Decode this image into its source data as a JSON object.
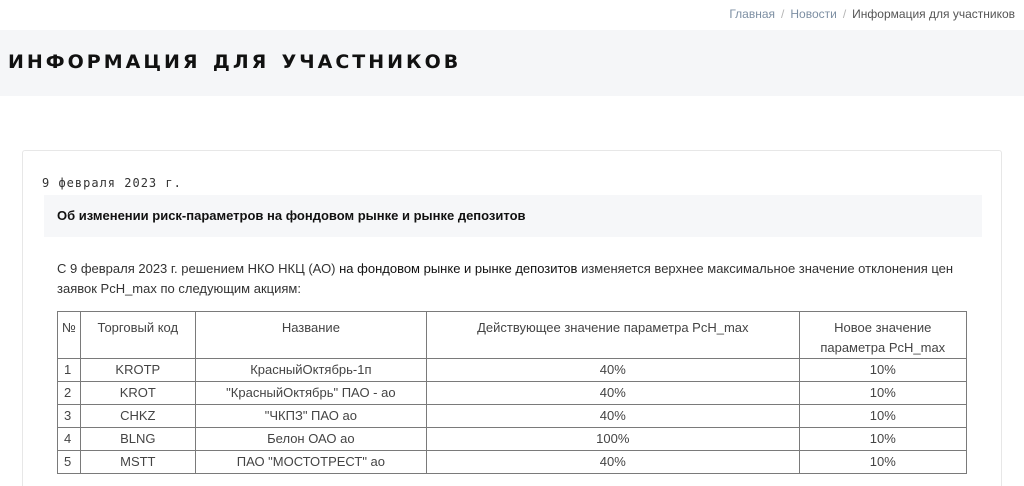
{
  "breadcrumb": {
    "home": "Главная",
    "news": "Новости",
    "current": "Информация для участников"
  },
  "page": {
    "title": "Информация для участников"
  },
  "article": {
    "date": "9 февраля 2023 г.",
    "heading": "Об изменении риск-параметров на фондовом рынке и рынке депозитов",
    "intro_part1": "С 9 февраля 2023 г. решением НКО НКЦ (АО) ",
    "intro_highlight": "на фондовом рынке и рынке депозитов",
    "intro_part2": " изменяется верхнее максимальное значение отклонения цен заявок PcH_max по следующим акциям:"
  },
  "table": {
    "headers": [
      "№",
      "Торговый код",
      "Название",
      "Действующее значение параметра PcH_max",
      "Новое значение параметра PcH_max"
    ],
    "rows": [
      [
        "1",
        "KROTP",
        "КрасныйОктябрь-1п",
        "40%",
        "10%"
      ],
      [
        "2",
        "KROT",
        "\"КрасныйОктябрь\" ПАО - ао",
        "40%",
        "10%"
      ],
      [
        "3",
        "CHKZ",
        "\"ЧКПЗ\" ПАО ао",
        "40%",
        "10%"
      ],
      [
        "4",
        "BLNG",
        "Белон ОАО ао",
        "100%",
        "10%"
      ],
      [
        "5",
        "MSTT",
        "ПАО \"МОСТОТРЕСТ\" ао",
        "40%",
        "10%"
      ]
    ]
  }
}
